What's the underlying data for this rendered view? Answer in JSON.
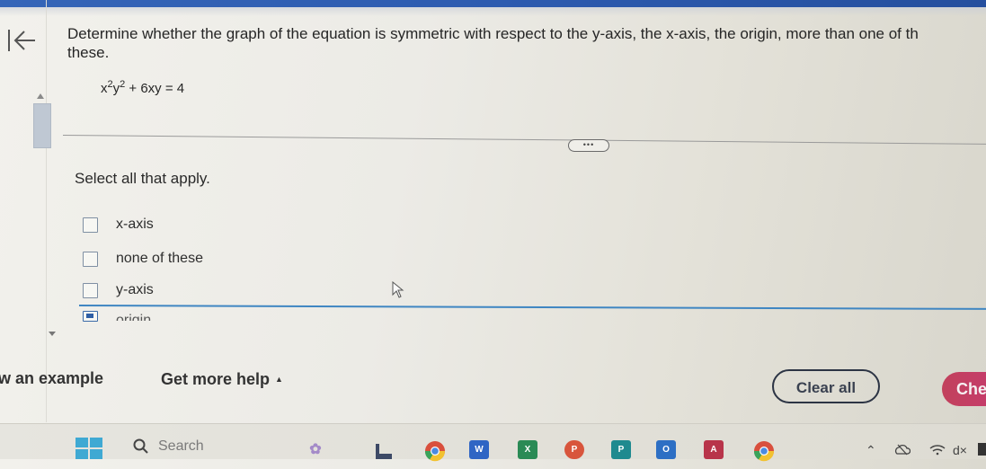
{
  "question": {
    "line1": "Determine whether the graph of the equation is symmetric with respect to the y-axis, the x-axis, the origin, more than one of th",
    "line2": "these.",
    "equation": {
      "x_term": "x",
      "x_exp": "2",
      "y_term": "y",
      "y_exp": "2",
      "rest": " + 6xy = 4"
    },
    "more_button": "•••",
    "instruction": "Select all that apply."
  },
  "options": [
    {
      "label": "x-axis",
      "checked": false
    },
    {
      "label": "none of these",
      "checked": false
    },
    {
      "label": "y-axis",
      "checked": false
    },
    {
      "label": "origin",
      "checked": false
    }
  ],
  "footer": {
    "show_example": "w an example",
    "get_more_help": "Get more help",
    "get_more_help_caret": "▲",
    "clear_all": "Clear all",
    "check_answer": "Che"
  },
  "taskbar": {
    "search_placeholder": "Search",
    "apps": [
      {
        "name": "widgets",
        "letter": ""
      },
      {
        "name": "file-explorer",
        "letter": "L"
      },
      {
        "name": "chrome",
        "letter": ""
      },
      {
        "name": "word",
        "letter": "W"
      },
      {
        "name": "excel",
        "letter": "X"
      },
      {
        "name": "powerpoint",
        "letter": "P"
      },
      {
        "name": "publisher",
        "letter": "P"
      },
      {
        "name": "outlook",
        "letter": "O"
      },
      {
        "name": "access",
        "letter": "A"
      },
      {
        "name": "chrome-2",
        "letter": ""
      }
    ],
    "tray": {
      "chevron": "⌃",
      "wifi": "◠",
      "volume": "d×"
    }
  },
  "colors": {
    "topbar": "#2d5bb0",
    "check_button": "#c63a72",
    "focus_line": "#3f86c2"
  }
}
